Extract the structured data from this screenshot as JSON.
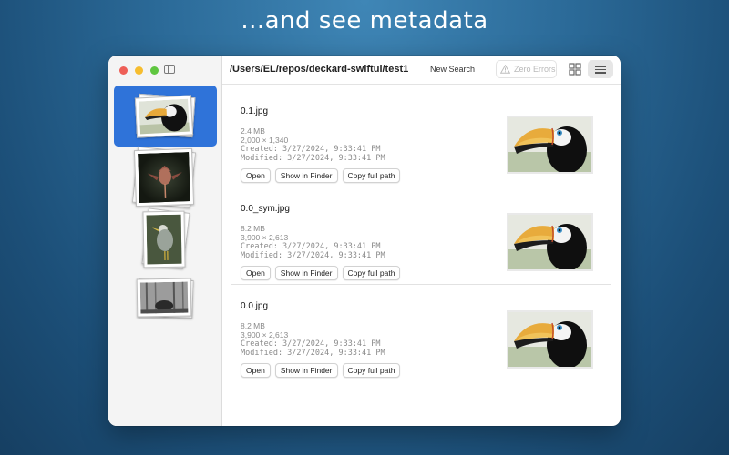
{
  "headline": "...and see metadata",
  "toolbar": {
    "path": "/Users/EL/repos/deckard-swiftui/test1",
    "new_search": "New Search",
    "zero_errors": "Zero Errors"
  },
  "files": [
    {
      "name": "0.1.jpg",
      "size": "2.4 MB",
      "dimensions": "2,000 × 1,340",
      "created": "Created:  3/27/2024, 9:33:41 PM",
      "modified": "Modified: 3/27/2024, 9:33:41 PM",
      "open": "Open",
      "show": "Show in Finder",
      "copy": "Copy full path"
    },
    {
      "name": "0.0_sym.jpg",
      "size": "8.2 MB",
      "dimensions": "3,900 × 2,613",
      "created": "Created:  3/27/2024, 9:33:41 PM",
      "modified": "Modified: 3/27/2024, 9:33:41 PM",
      "open": "Open",
      "show": "Show in Finder",
      "copy": "Copy full path"
    },
    {
      "name": "0.0.jpg",
      "size": "8.2 MB",
      "dimensions": "3,900 × 2,613",
      "created": "Created:  3/27/2024, 9:33:41 PM",
      "modified": "Modified: 3/27/2024, 9:33:41 PM",
      "open": "Open",
      "show": "Show in Finder",
      "copy": "Copy full path"
    }
  ],
  "colors": {
    "selection": "#2f73d9",
    "close": "#ee5f57",
    "minimize": "#f6bd2f",
    "zoom": "#5fc640"
  },
  "icons": [
    "sidebar-toggle-icon",
    "warning-icon",
    "grid-view-icon",
    "list-view-icon"
  ]
}
